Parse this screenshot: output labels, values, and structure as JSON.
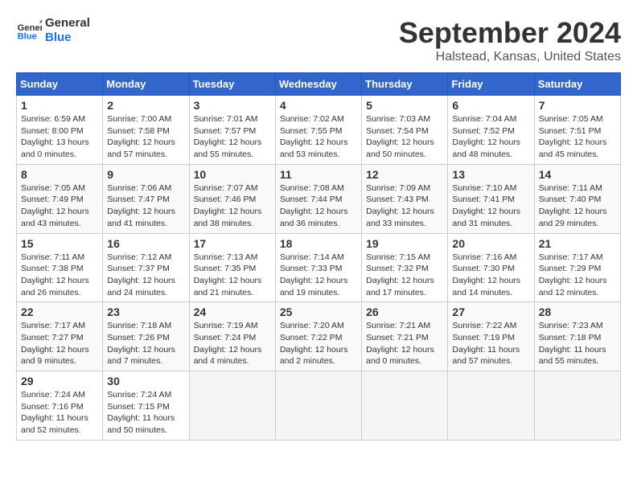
{
  "header": {
    "logo_general": "General",
    "logo_blue": "Blue",
    "month": "September 2024",
    "location": "Halstead, Kansas, United States"
  },
  "weekdays": [
    "Sunday",
    "Monday",
    "Tuesday",
    "Wednesday",
    "Thursday",
    "Friday",
    "Saturday"
  ],
  "weeks": [
    [
      {
        "day": 1,
        "info": "Sunrise: 6:59 AM\nSunset: 8:00 PM\nDaylight: 13 hours\nand 0 minutes."
      },
      {
        "day": 2,
        "info": "Sunrise: 7:00 AM\nSunset: 7:58 PM\nDaylight: 12 hours\nand 57 minutes."
      },
      {
        "day": 3,
        "info": "Sunrise: 7:01 AM\nSunset: 7:57 PM\nDaylight: 12 hours\nand 55 minutes."
      },
      {
        "day": 4,
        "info": "Sunrise: 7:02 AM\nSunset: 7:55 PM\nDaylight: 12 hours\nand 53 minutes."
      },
      {
        "day": 5,
        "info": "Sunrise: 7:03 AM\nSunset: 7:54 PM\nDaylight: 12 hours\nand 50 minutes."
      },
      {
        "day": 6,
        "info": "Sunrise: 7:04 AM\nSunset: 7:52 PM\nDaylight: 12 hours\nand 48 minutes."
      },
      {
        "day": 7,
        "info": "Sunrise: 7:05 AM\nSunset: 7:51 PM\nDaylight: 12 hours\nand 45 minutes."
      }
    ],
    [
      {
        "day": 8,
        "info": "Sunrise: 7:05 AM\nSunset: 7:49 PM\nDaylight: 12 hours\nand 43 minutes."
      },
      {
        "day": 9,
        "info": "Sunrise: 7:06 AM\nSunset: 7:47 PM\nDaylight: 12 hours\nand 41 minutes."
      },
      {
        "day": 10,
        "info": "Sunrise: 7:07 AM\nSunset: 7:46 PM\nDaylight: 12 hours\nand 38 minutes."
      },
      {
        "day": 11,
        "info": "Sunrise: 7:08 AM\nSunset: 7:44 PM\nDaylight: 12 hours\nand 36 minutes."
      },
      {
        "day": 12,
        "info": "Sunrise: 7:09 AM\nSunset: 7:43 PM\nDaylight: 12 hours\nand 33 minutes."
      },
      {
        "day": 13,
        "info": "Sunrise: 7:10 AM\nSunset: 7:41 PM\nDaylight: 12 hours\nand 31 minutes."
      },
      {
        "day": 14,
        "info": "Sunrise: 7:11 AM\nSunset: 7:40 PM\nDaylight: 12 hours\nand 29 minutes."
      }
    ],
    [
      {
        "day": 15,
        "info": "Sunrise: 7:11 AM\nSunset: 7:38 PM\nDaylight: 12 hours\nand 26 minutes."
      },
      {
        "day": 16,
        "info": "Sunrise: 7:12 AM\nSunset: 7:37 PM\nDaylight: 12 hours\nand 24 minutes."
      },
      {
        "day": 17,
        "info": "Sunrise: 7:13 AM\nSunset: 7:35 PM\nDaylight: 12 hours\nand 21 minutes."
      },
      {
        "day": 18,
        "info": "Sunrise: 7:14 AM\nSunset: 7:33 PM\nDaylight: 12 hours\nand 19 minutes."
      },
      {
        "day": 19,
        "info": "Sunrise: 7:15 AM\nSunset: 7:32 PM\nDaylight: 12 hours\nand 17 minutes."
      },
      {
        "day": 20,
        "info": "Sunrise: 7:16 AM\nSunset: 7:30 PM\nDaylight: 12 hours\nand 14 minutes."
      },
      {
        "day": 21,
        "info": "Sunrise: 7:17 AM\nSunset: 7:29 PM\nDaylight: 12 hours\nand 12 minutes."
      }
    ],
    [
      {
        "day": 22,
        "info": "Sunrise: 7:17 AM\nSunset: 7:27 PM\nDaylight: 12 hours\nand 9 minutes."
      },
      {
        "day": 23,
        "info": "Sunrise: 7:18 AM\nSunset: 7:26 PM\nDaylight: 12 hours\nand 7 minutes."
      },
      {
        "day": 24,
        "info": "Sunrise: 7:19 AM\nSunset: 7:24 PM\nDaylight: 12 hours\nand 4 minutes."
      },
      {
        "day": 25,
        "info": "Sunrise: 7:20 AM\nSunset: 7:22 PM\nDaylight: 12 hours\nand 2 minutes."
      },
      {
        "day": 26,
        "info": "Sunrise: 7:21 AM\nSunset: 7:21 PM\nDaylight: 12 hours\nand 0 minutes."
      },
      {
        "day": 27,
        "info": "Sunrise: 7:22 AM\nSunset: 7:19 PM\nDaylight: 11 hours\nand 57 minutes."
      },
      {
        "day": 28,
        "info": "Sunrise: 7:23 AM\nSunset: 7:18 PM\nDaylight: 11 hours\nand 55 minutes."
      }
    ],
    [
      {
        "day": 29,
        "info": "Sunrise: 7:24 AM\nSunset: 7:16 PM\nDaylight: 11 hours\nand 52 minutes."
      },
      {
        "day": 30,
        "info": "Sunrise: 7:24 AM\nSunset: 7:15 PM\nDaylight: 11 hours\nand 50 minutes."
      },
      null,
      null,
      null,
      null,
      null
    ]
  ]
}
